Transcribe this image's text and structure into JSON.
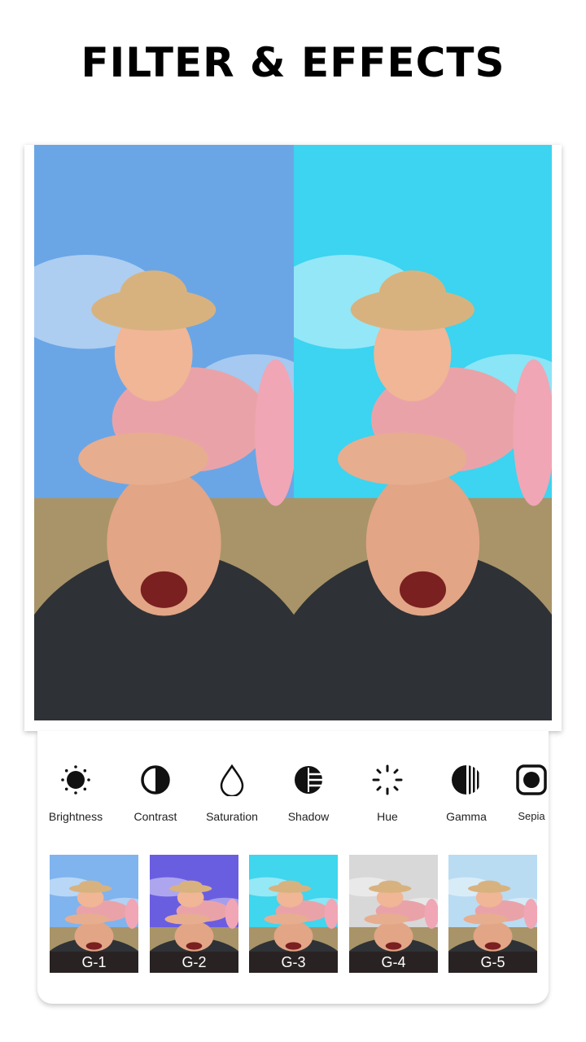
{
  "title": "FILTER & EFFECTS",
  "preview": {
    "left_filter": "original",
    "right_filter": "cyan"
  },
  "tools": [
    {
      "label": "Brightness",
      "icon": "brightness-icon"
    },
    {
      "label": "Contrast",
      "icon": "contrast-icon"
    },
    {
      "label": "Saturation",
      "icon": "saturation-drop-icon"
    },
    {
      "label": "Shadow",
      "icon": "shadow-icon"
    },
    {
      "label": "Hue",
      "icon": "hue-icon"
    },
    {
      "label": "Gamma",
      "icon": "gamma-icon"
    },
    {
      "label": "Sepia",
      "icon": "sepia-icon"
    }
  ],
  "filters": [
    {
      "label": "G-1",
      "color": "#7fb4ee"
    },
    {
      "label": "G-2",
      "color": "#6a5ee0"
    },
    {
      "label": "G-3",
      "color": "#3fd6ee"
    },
    {
      "label": "G-4",
      "color": "#d8d8d8"
    },
    {
      "label": "G-5",
      "color": "#b9dcf2"
    }
  ]
}
